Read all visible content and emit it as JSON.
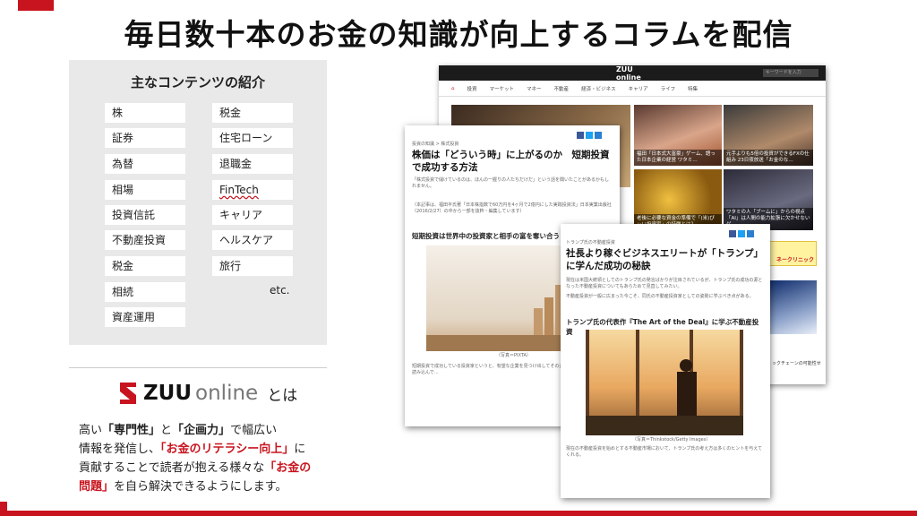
{
  "title": "毎日数十本のお金の知識が向上するコラムを配信",
  "contents": {
    "heading": "主なコンテンツの紹介",
    "left_items": [
      "株",
      "証券",
      "為替",
      "相場",
      "投資信託",
      "不動産投資",
      "税金",
      "相続",
      "資産運用"
    ],
    "right_items": [
      "税金",
      "住宅ローン",
      "退職金",
      "FinTech",
      "キャリア",
      "ヘルスケア",
      "旅行"
    ],
    "etc": "etc."
  },
  "brand": {
    "zuu": "ZUU",
    "online": "online",
    "toha": "とは",
    "colors": {
      "accent": "#c8141e",
      "dark": "#1b1b1b"
    }
  },
  "description": {
    "p1": "高い",
    "p2": "「専門性」",
    "p3": "と",
    "p4": "「企画力」",
    "p5": "で幅広い",
    "p6": "情報を発信し、",
    "p7": "「お金のリテラシー向上」",
    "p8": "に",
    "p9": "貢献することで読者が抱える様々な",
    "p10": "「お金の",
    "p11": "問題」",
    "p12": "を自ら解決できるようにします。"
  },
  "site": {
    "logo": "ZUU online",
    "search": "キーワードを入力",
    "nav": [
      "投資",
      "マーケット",
      "マネー",
      "不動産",
      "経済・ビジネス",
      "キャリア",
      "ライフ",
      "特集"
    ],
    "tile_caps": [
      "福田「日本式大富豪」ゲーム、語った日本企業の経営 ワタミ…",
      "元手よりも5倍の投資ができるFXの仕組み 23日夜放送「お金のな…",
      "老後に必要な資金の準備で「(米)ぴぃい投資家」の特徴とは？",
      "ワタミの人「ブームに」からの視点「AI」は人間の能力拡張に欠かせないゲ…",
      "ックチェーンの可能性せ",
      "ネークリニック"
    ]
  },
  "article1": {
    "crumb": "投資の知識 > 株式投資",
    "headline": "株価は「どういう時」に上がるのか　短期投資で成功する方法",
    "body1": "「株式投資で儲けているのは、ほんの一握りの人たちだけだ」という話を聞いたことがあるかもしれません。",
    "note": "（本記事は、福田平氏著「日本株指数で60万円を4ヶ月で2億円にした実践投資法」日本実業出版社（2016/2/27）の中から一部を抜粋・編集しています）",
    "subhead": "短期投資は世界中の投資家と相手の富を奪い合う",
    "caption": "（写真＝PIXTA）",
    "body2": "短期投資で成功している投資家というと、有望な企業を見つけ出してその企業が持っている特性を読み込んで…"
  },
  "article2": {
    "crumb": "トランプ氏の不動産投資",
    "headline": "社長より稼ぐビジネスエリートが「トランプ」に学んだ成功の秘訣",
    "body1": "現在は米国大統領としてのトランプ氏の発言ばかりが注目されているが、トランプ氏の成功の源となった不動産投資についてもあらためて見直してみたい。",
    "body2": "不動産投資が一般に広まった今こそ、同氏の不動産投資家としての姿勢に学ぶべき点がある。",
    "subhead": "トランプ氏の代表作『The Art of the Deal』に学ぶ不動産投資",
    "caption": "（写真＝Thinkstock/Getty Images）",
    "body3": "現在の不動産投資を始めとする不動産市場において、トランプ氏の考え方は多くのヒントを与えてくれる。"
  }
}
